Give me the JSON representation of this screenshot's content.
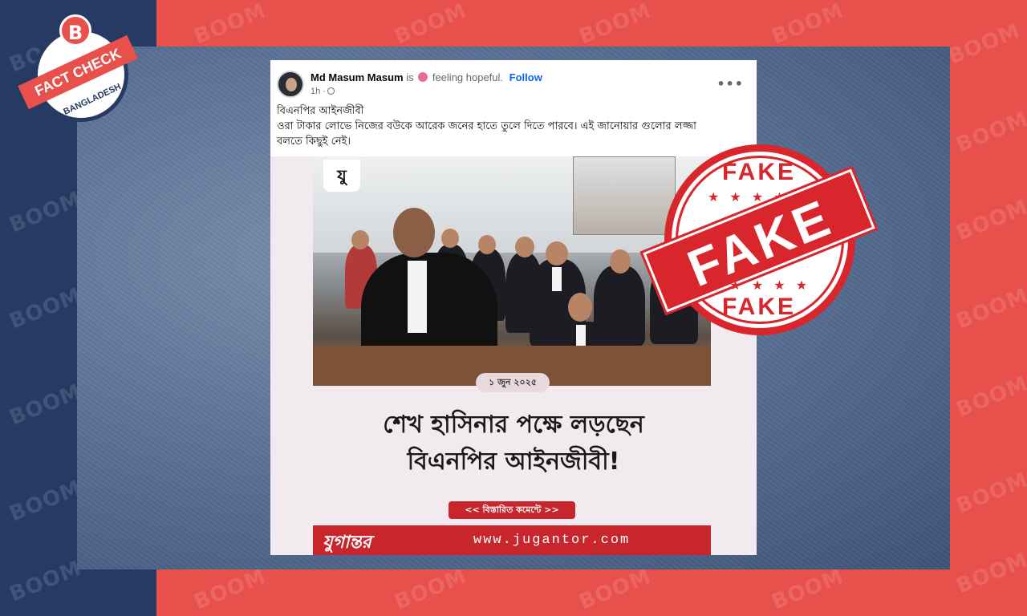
{
  "brand": {
    "logo_letter": "B",
    "badge_ribbon": "FACT CHECK",
    "badge_country": "BANGLADESH",
    "watermark": "BOOM"
  },
  "post": {
    "author": "Md Masum Masum",
    "is_text": "is",
    "feeling": "feeling hopeful.",
    "follow_label": "Follow",
    "time": "1h ·",
    "more_label": "•••",
    "text_line1": "বিএনপির আইনজীবী",
    "text_line2": "ওরা টাকার লোভে নিজের বউকে আরেক জনের হাতে তুলে দিতে পারবে। এই জানোয়ার গুলোর লজ্জা",
    "text_line3": "বলতে কিছুই নেই।"
  },
  "post_image": {
    "tag": "যু",
    "date": "১ জুন ২০২৫",
    "headline_line1": "শেখ হাসিনার পক্ষে লড়ছেন",
    "headline_line2": "বিএনপির আইনজীবী!",
    "more_button": "<< বিস্তারিত কমেন্টে >>",
    "footer_logo": "যুগান্তর",
    "footer_url": "www.jugantor.com"
  },
  "stamp": {
    "top": "FAKE",
    "main": "FAKE",
    "bottom": "FAKE",
    "stars": "★ ★ ★ ★ ★"
  },
  "colors": {
    "brand_red": "#e8504c",
    "navy": "#273a63",
    "stamp_red": "#d8262c",
    "fb_blue": "#0866ff"
  }
}
